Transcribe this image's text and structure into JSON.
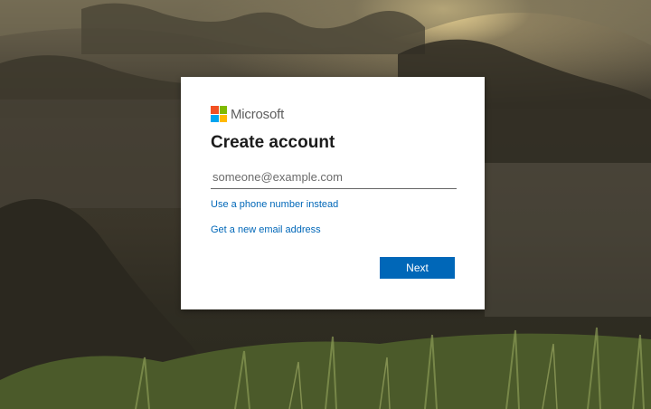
{
  "brand": {
    "name": "Microsoft",
    "logo_colors": [
      "#f25022",
      "#7fba00",
      "#00a4ef",
      "#ffb900"
    ]
  },
  "card": {
    "title": "Create account",
    "email_placeholder": "someone@example.com",
    "email_value": "",
    "phone_link": "Use a phone number instead",
    "new_email_link": "Get a new email address",
    "next_label": "Next"
  },
  "colors": {
    "accent": "#0067b8",
    "card_bg": "#ffffff"
  }
}
